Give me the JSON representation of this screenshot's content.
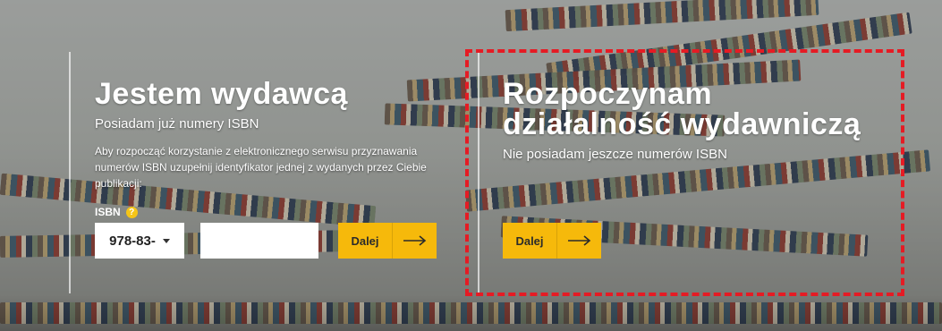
{
  "left": {
    "title": "Jestem wydawcą",
    "subtitle": "Posiadam już numery ISBN",
    "description": "Aby rozpocząć korzystanie z elektronicznego serwisu przyznawania numerów ISBN uzupełnij identyfikator jednej z wydanych przez Ciebie publikacji:",
    "isbn_label": "ISBN",
    "help_icon": "?",
    "prefix_selected": "978-83-",
    "input_value": "",
    "button_label": "Dalej"
  },
  "right": {
    "title": "Rozpoczynam działalność wydawniczą",
    "subtitle": "Nie posiadam jeszcze numerów ISBN",
    "button_label": "Dalej"
  },
  "colors": {
    "accent": "#f6b90b",
    "highlight": "#e51b24"
  },
  "icons": {
    "help": "help-icon",
    "dropdown": "chevron-down-icon",
    "arrow": "arrow-right-icon"
  }
}
